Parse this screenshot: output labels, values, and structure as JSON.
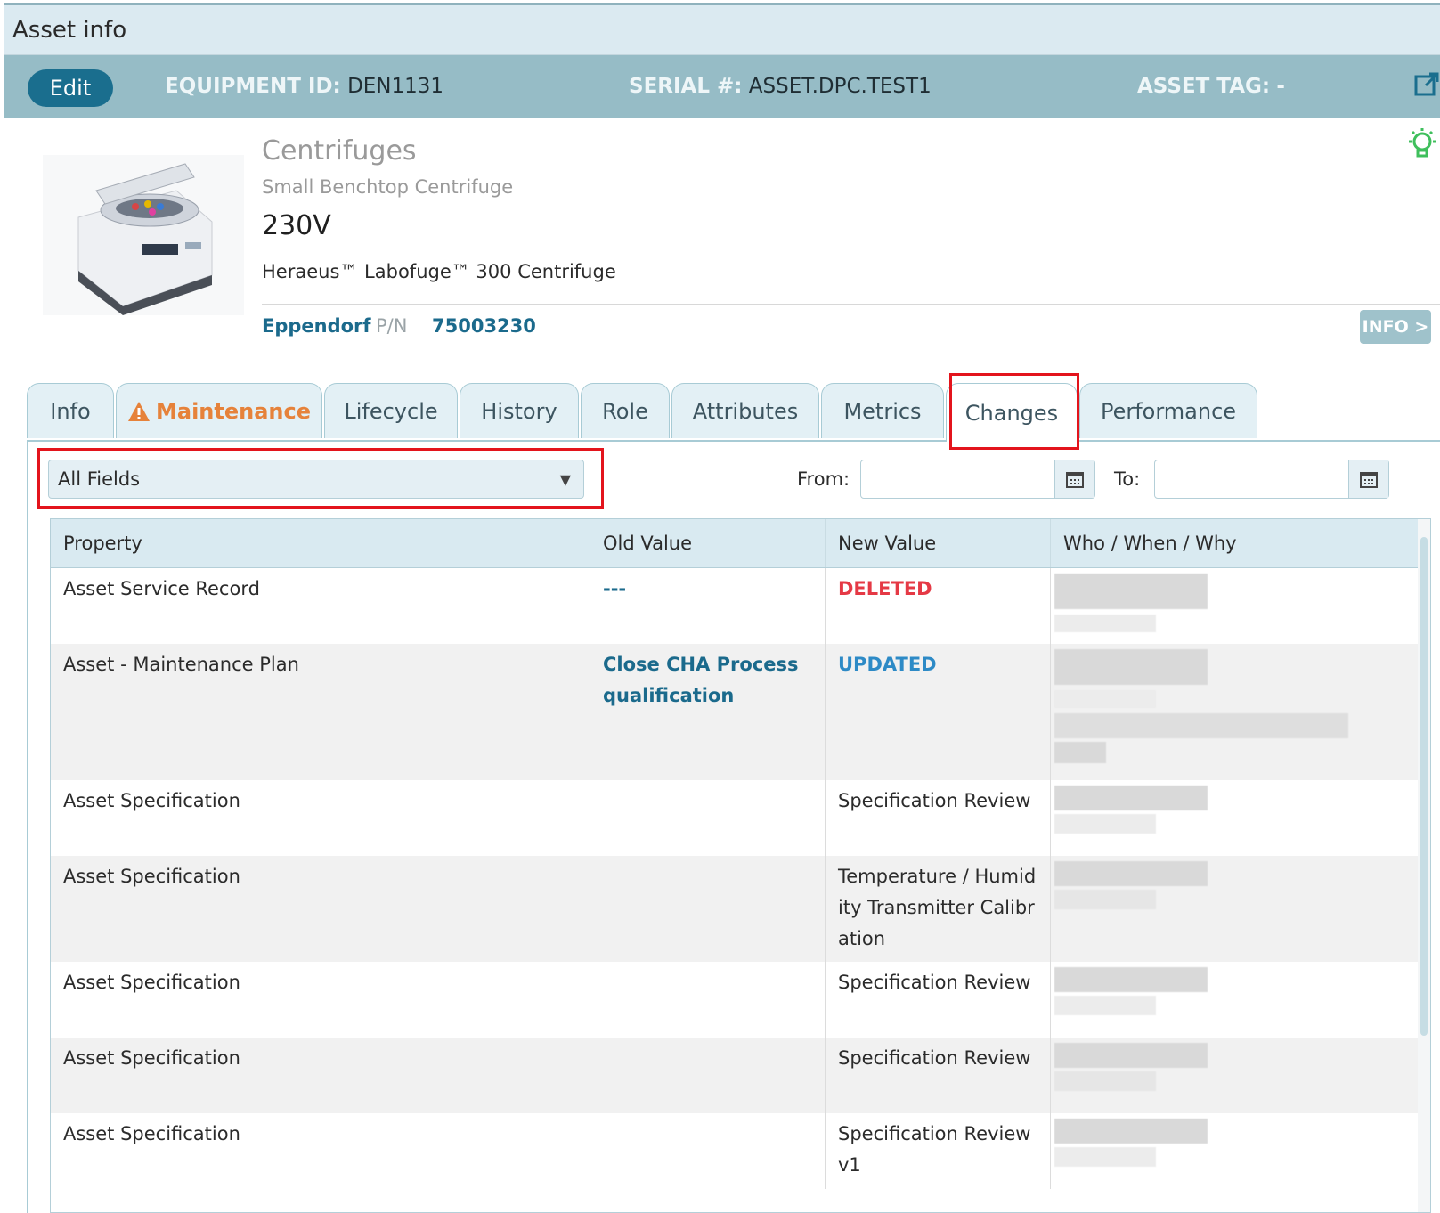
{
  "window": {
    "title": "Asset info"
  },
  "header": {
    "edit_label": "Edit",
    "equipment_id_label": "EQUIPMENT ID:",
    "equipment_id": "DEN1131",
    "serial_label": "SERIAL #:",
    "serial": "ASSET.DPC.TEST1",
    "asset_tag_label": "ASSET TAG:",
    "asset_tag": "-"
  },
  "asset": {
    "category": "Centrifuges",
    "subcategory": "Small Benchtop Centrifuge",
    "voltage": "230V",
    "model": "Heraeus™ Labofuge™ 300 Centrifuge",
    "manufacturer": "Eppendorf",
    "pn_label": "P/N",
    "pn": "75003230",
    "info_button": "INFO >"
  },
  "tabs": [
    {
      "label": "Info"
    },
    {
      "label": "Maintenance",
      "warning": true
    },
    {
      "label": "Lifecycle"
    },
    {
      "label": "History"
    },
    {
      "label": "Role"
    },
    {
      "label": "Attributes"
    },
    {
      "label": "Metrics"
    },
    {
      "label": "Changes",
      "active": true
    },
    {
      "label": "Performance"
    }
  ],
  "filter": {
    "field_select": "All Fields",
    "from_label": "From:",
    "to_label": "To:",
    "from_value": "",
    "to_value": ""
  },
  "table": {
    "headers": [
      "Property",
      "Old Value",
      "New Value",
      "Who / When / Why"
    ],
    "rows": [
      {
        "property": "Asset Service Record",
        "old": "---",
        "new": "DELETED"
      },
      {
        "property": "Asset - Maintenance Plan",
        "old": "Close CHA Process qualification",
        "new": "UPDATED"
      },
      {
        "property": "Asset Specification",
        "old": "",
        "new": "Specification Review"
      },
      {
        "property": "Asset Specification",
        "old": "",
        "new": "Temperature / Humidity Transmitter Calibration"
      },
      {
        "property": "Asset Specification",
        "old": "",
        "new": "Specification Review"
      },
      {
        "property": "Asset Specification",
        "old": "",
        "new": "Specification Review"
      },
      {
        "property": "Asset Specification",
        "old": "",
        "new": "Specification Review v1"
      }
    ]
  },
  "colors": {
    "header_bg": "#96bcc6",
    "accent": "#1b6a8c",
    "deleted": "#e53945",
    "updated": "#2d8ac6",
    "warning": "#e6823a",
    "highlight": "#e3141c"
  }
}
